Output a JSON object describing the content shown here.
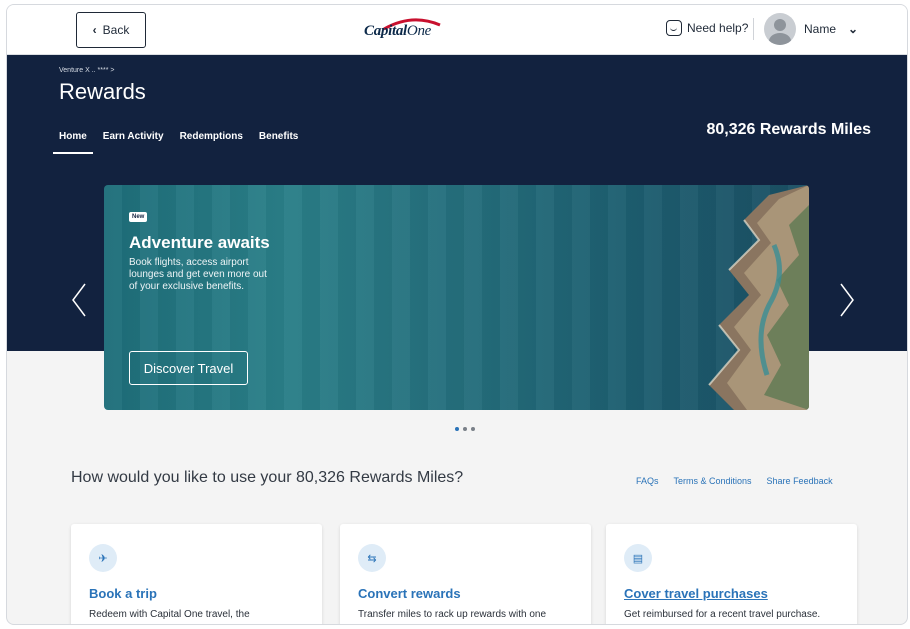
{
  "header": {
    "back_label": "Back",
    "logo_text_a": "Capital",
    "logo_text_b": "One",
    "help_label": "Need help?",
    "user_name": "Name"
  },
  "rewards": {
    "breadcrumb": "Venture X .. **** >",
    "title": "Rewards",
    "tabs": [
      {
        "label": "Home",
        "active": true
      },
      {
        "label": "Earn Activity"
      },
      {
        "label": "Redemptions"
      },
      {
        "label": "Benefits"
      }
    ],
    "miles_balance": "80,326 Rewards Miles"
  },
  "banner": {
    "badge": "New",
    "title": "Adventure awaits",
    "description": "Book flights, access airport lounges and get even more out of your exclusive benefits.",
    "cta": "Discover Travel",
    "slides_total": 3,
    "active_slide": 1
  },
  "question": "How would you like to use your 80,326 Rewards Miles?",
  "links": [
    "FAQs",
    "Terms & Conditions",
    "Share Feedback"
  ],
  "cards": [
    {
      "title": "Book a trip",
      "description": "Redeem with Capital One travel, the",
      "icon": "plane-icon"
    },
    {
      "title": "Convert rewards",
      "description": "Transfer miles to rack up rewards with one",
      "icon": "transfer-arrows-icon"
    },
    {
      "title": "Cover travel purchases",
      "description": "Get reimbursed for a recent travel purchase.",
      "icon": "receipt-icon"
    }
  ],
  "colors": {
    "navy": "#12223f",
    "accent_blue": "#2a73b8",
    "banner_teal": "#1e6e7a"
  }
}
